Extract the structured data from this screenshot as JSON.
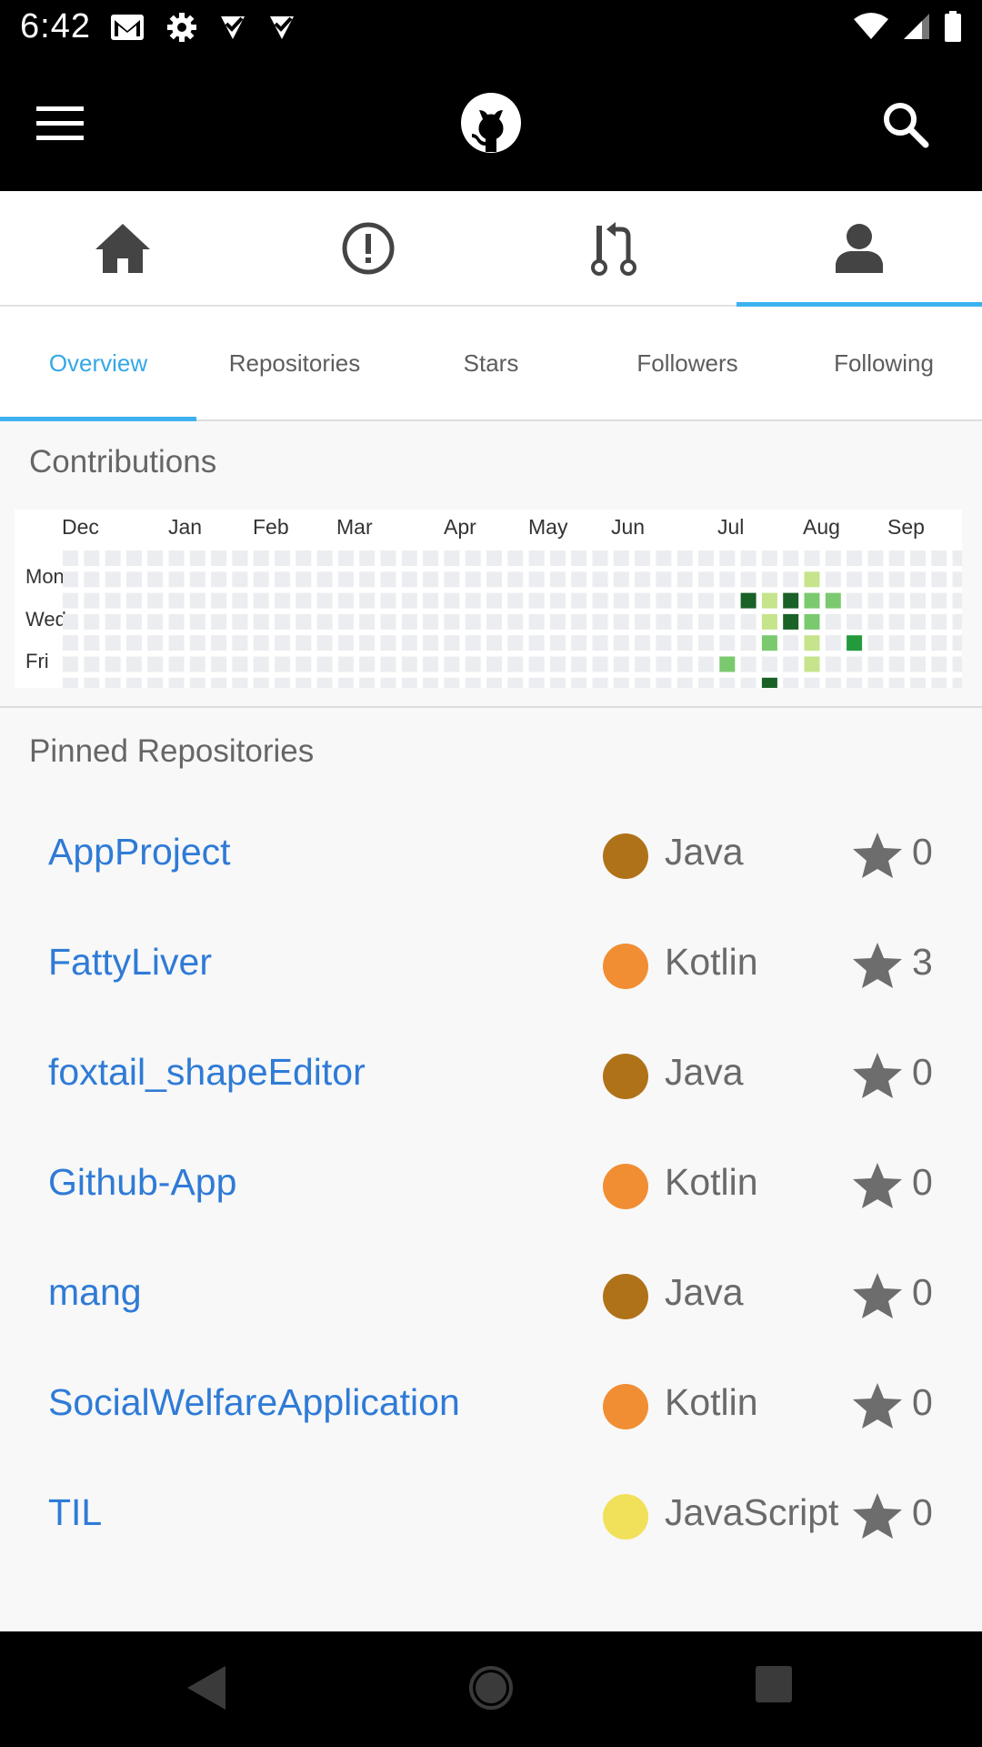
{
  "status_bar": {
    "time": "6:42",
    "left_icons": [
      "gmail-icon",
      "settings-icon",
      "task-check-icon",
      "task-check-icon"
    ],
    "right_icons": [
      "wifi-icon",
      "cell-signal-icon",
      "battery-icon"
    ]
  },
  "app_bar": {
    "menu_icon": "hamburger-menu-icon",
    "logo_icon": "github-octocat-icon",
    "search_icon": "search-icon"
  },
  "main_nav": {
    "items": [
      {
        "icon": "home-icon",
        "active": false
      },
      {
        "icon": "issues-icon",
        "active": false
      },
      {
        "icon": "pull-request-icon",
        "active": false
      },
      {
        "icon": "profile-icon",
        "active": true
      }
    ]
  },
  "sub_tabs": [
    {
      "label": "Overview",
      "active": true
    },
    {
      "label": "Repositories",
      "active": false
    },
    {
      "label": "Stars",
      "active": false
    },
    {
      "label": "Followers",
      "active": false
    },
    {
      "label": "Following",
      "active": false
    }
  ],
  "contributions": {
    "title": "Contributions",
    "months": [
      "Dec",
      "Jan",
      "Feb",
      "Mar",
      "Apr",
      "May",
      "Jun",
      "Jul",
      "Aug",
      "Sep"
    ],
    "days": [
      "Mon",
      "Wed",
      "Fri"
    ],
    "colors": {
      "empty": "#ebedf0",
      "level1": "#c6e48b",
      "level2": "#7bc96f",
      "level3": "#239a3b",
      "level4": "#196127"
    },
    "active_cells": [
      {
        "week": 35,
        "day": 1,
        "level": 1
      },
      {
        "week": 32,
        "day": 2,
        "level": 4
      },
      {
        "week": 33,
        "day": 2,
        "level": 1
      },
      {
        "week": 34,
        "day": 2,
        "level": 4
      },
      {
        "week": 35,
        "day": 2,
        "level": 2
      },
      {
        "week": 36,
        "day": 2,
        "level": 2
      },
      {
        "week": 33,
        "day": 3,
        "level": 1
      },
      {
        "week": 34,
        "day": 3,
        "level": 4
      },
      {
        "week": 35,
        "day": 3,
        "level": 2
      },
      {
        "week": 33,
        "day": 4,
        "level": 2
      },
      {
        "week": 35,
        "day": 4,
        "level": 1
      },
      {
        "week": 37,
        "day": 4,
        "level": 3
      },
      {
        "week": 31,
        "day": 5,
        "level": 2
      },
      {
        "week": 35,
        "day": 5,
        "level": 1
      },
      {
        "week": 33,
        "day": 6,
        "level": 4
      }
    ]
  },
  "pinned": {
    "title": "Pinned Repositories",
    "repos": [
      {
        "name": "AppProject",
        "language": "Java",
        "lang_color": "#b07219",
        "stars": "0"
      },
      {
        "name": "FattyLiver",
        "language": "Kotlin",
        "lang_color": "#f18e33",
        "stars": "3"
      },
      {
        "name": "foxtail_shapeEditor",
        "language": "Java",
        "lang_color": "#b07219",
        "stars": "0"
      },
      {
        "name": "Github-App",
        "language": "Kotlin",
        "lang_color": "#f18e33",
        "stars": "0"
      },
      {
        "name": "mang",
        "language": "Java",
        "lang_color": "#b07219",
        "stars": "0"
      },
      {
        "name": "SocialWelfareApplication",
        "language": "Kotlin",
        "lang_color": "#f18e33",
        "stars": "0"
      },
      {
        "name": "TIL",
        "language": "JavaScript",
        "lang_color": "#f1e05a",
        "stars": "0"
      }
    ]
  },
  "system_nav": {
    "icons": [
      "back-icon",
      "home-circle-icon",
      "recents-icon"
    ]
  }
}
